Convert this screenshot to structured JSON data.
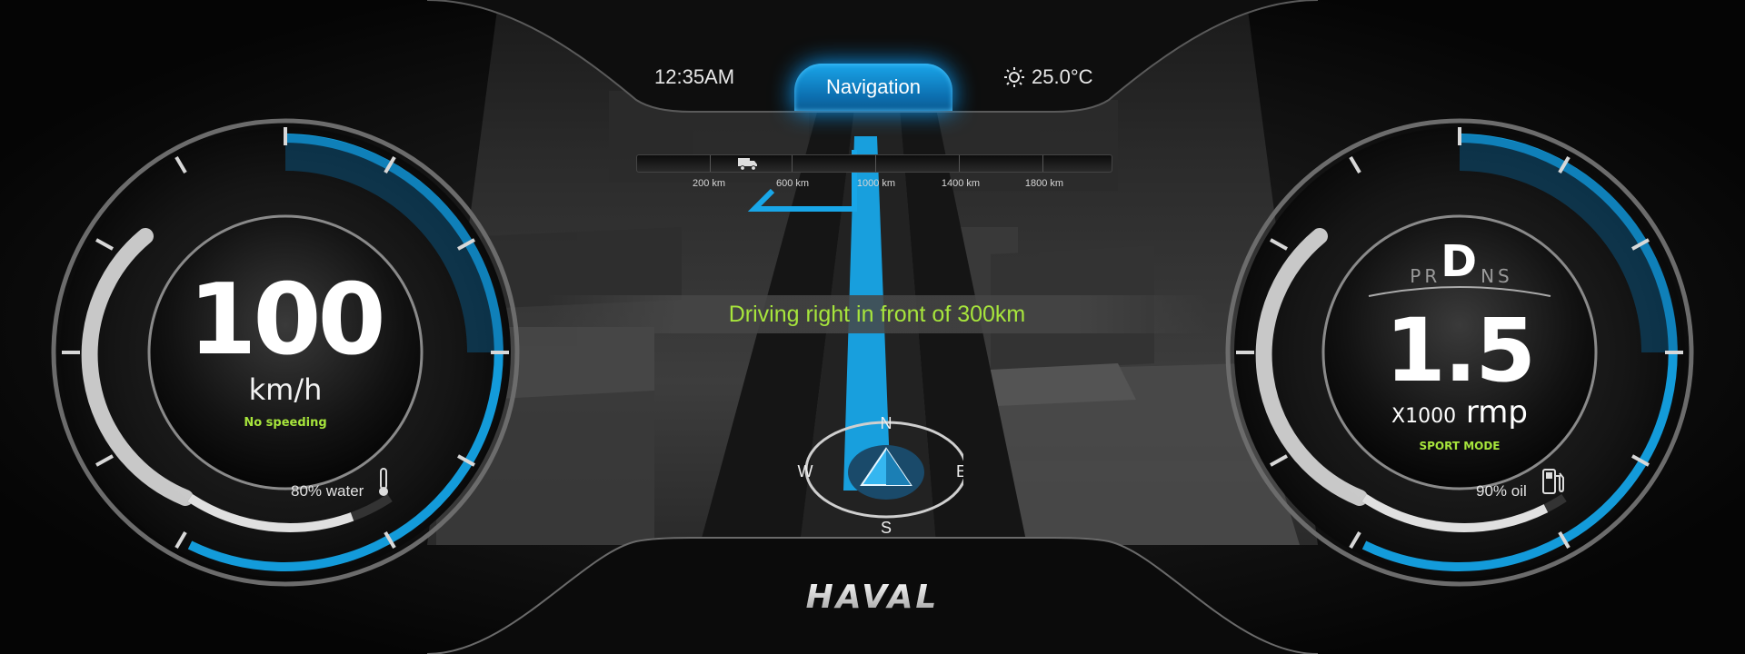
{
  "header": {
    "time": "12:35AM",
    "nav_tab_label": "Navigation",
    "temperature": "25.0°C",
    "weather_icon": "sun-icon"
  },
  "route": {
    "scale_labels": [
      "200 km",
      "600 km",
      "1000 km",
      "1400 km",
      "1800 km"
    ],
    "vehicle_icon": "truck-icon",
    "instruction": "Driving right in front of 300km"
  },
  "compass": {
    "north": "N",
    "south": "S",
    "east": "E",
    "west": "W",
    "arrow_icon": "navigation-arrow-icon"
  },
  "speedometer": {
    "value": "100",
    "unit": "km/h",
    "status": "No speeding",
    "water_label": "80% water",
    "water_icon": "thermometer-icon",
    "water_level": 0.8
  },
  "tachometer": {
    "gears": [
      "P",
      "R",
      "D",
      "N",
      "S"
    ],
    "active_gear": "D",
    "value": "1.5",
    "unit_multiplier": "X1000",
    "unit": "rmp",
    "mode": "SPORT MODE",
    "oil_label": "90% oil",
    "oil_icon": "fuel-pump-icon",
    "oil_level": 0.9
  },
  "brand": {
    "logo_text": "HAVAL"
  },
  "colors": {
    "accent_blue": "#1aa6ea",
    "status_green": "#a7e53c",
    "background": "#0a0a0a"
  }
}
